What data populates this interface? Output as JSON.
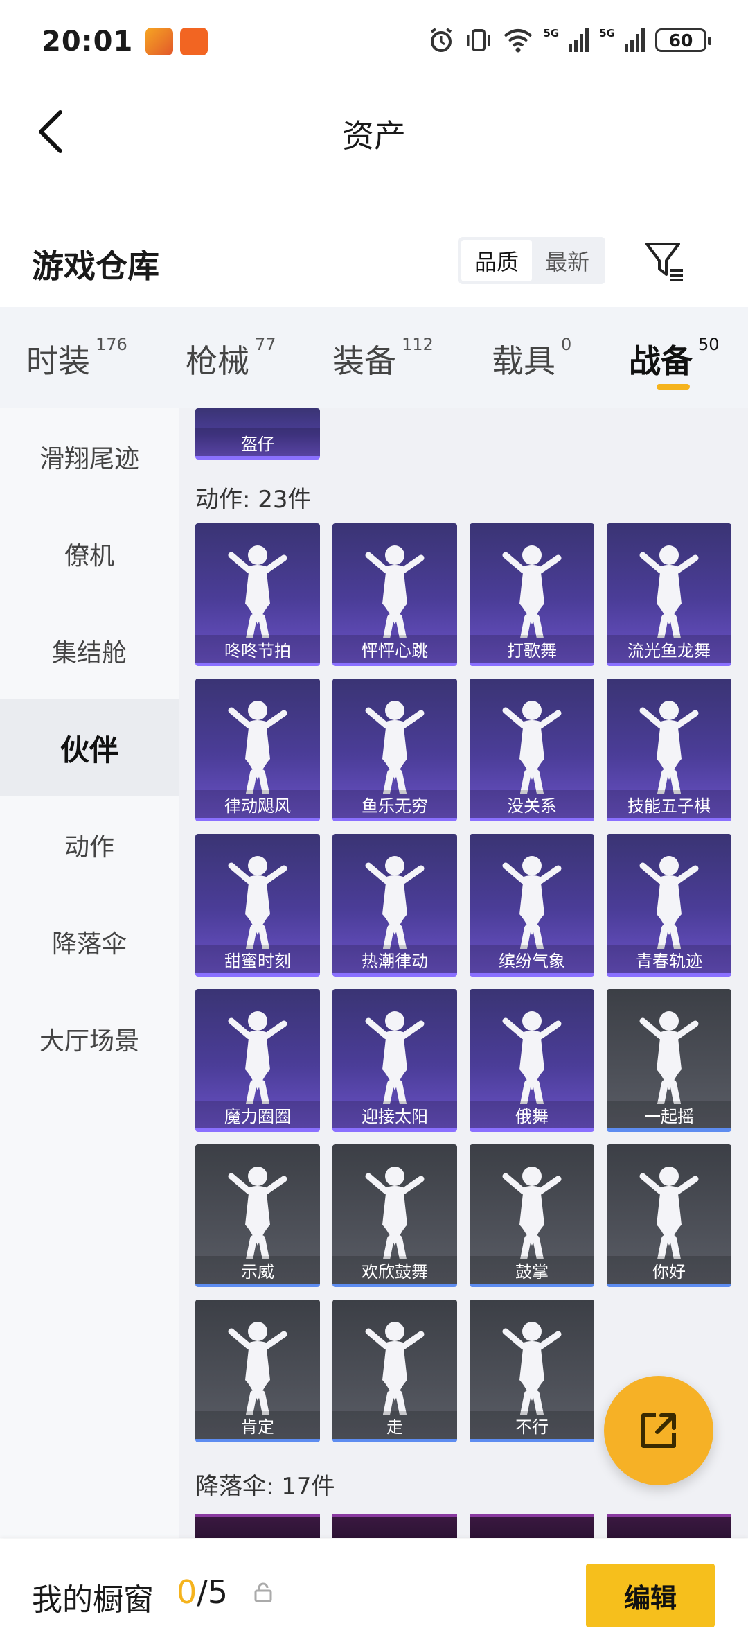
{
  "status_bar": {
    "time": "20:01",
    "battery": "60",
    "net1": "5G",
    "net2": "5G"
  },
  "header": {
    "title": "资产"
  },
  "warehouse": {
    "title": "游戏仓库",
    "sort_options": [
      "品质",
      "最新"
    ],
    "active_sort": "品质"
  },
  "tabs": [
    {
      "label": "时装",
      "count": "176"
    },
    {
      "label": "枪械",
      "count": "77"
    },
    {
      "label": "装备",
      "count": "112"
    },
    {
      "label": "载具",
      "count": "0"
    },
    {
      "label": "战备",
      "count": "50"
    }
  ],
  "active_tab": "战备",
  "sidebar": {
    "items": [
      "滑翔尾迹",
      "僚机",
      "集结舱",
      "伙伴",
      "动作",
      "降落伞",
      "大厅场景"
    ],
    "active": "伙伴"
  },
  "content": {
    "prev_item_label": "盔仔",
    "emote_section": "动作: 23件",
    "emotes": [
      {
        "label": "咚咚节拍",
        "rarity": "purple"
      },
      {
        "label": "怦怦心跳",
        "rarity": "purple"
      },
      {
        "label": "打歌舞",
        "rarity": "purple"
      },
      {
        "label": "流光鱼龙舞",
        "rarity": "purple"
      },
      {
        "label": "律动飓风",
        "rarity": "purple"
      },
      {
        "label": "鱼乐无穷",
        "rarity": "purple"
      },
      {
        "label": "没关系",
        "rarity": "purple"
      },
      {
        "label": "技能五子棋",
        "rarity": "purple"
      },
      {
        "label": "甜蜜时刻",
        "rarity": "purple"
      },
      {
        "label": "热潮律动",
        "rarity": "purple"
      },
      {
        "label": "缤纷气象",
        "rarity": "purple"
      },
      {
        "label": "青春轨迹",
        "rarity": "purple"
      },
      {
        "label": "魔力圈圈",
        "rarity": "purple"
      },
      {
        "label": "迎接太阳",
        "rarity": "purple"
      },
      {
        "label": "俄舞",
        "rarity": "purple"
      },
      {
        "label": "一起摇",
        "rarity": "gray"
      },
      {
        "label": "示威",
        "rarity": "gray"
      },
      {
        "label": "欢欣鼓舞",
        "rarity": "gray"
      },
      {
        "label": "鼓掌",
        "rarity": "gray"
      },
      {
        "label": "你好",
        "rarity": "gray"
      },
      {
        "label": "肯定",
        "rarity": "gray"
      },
      {
        "label": "走",
        "rarity": "gray"
      },
      {
        "label": "不行",
        "rarity": "gray"
      }
    ],
    "parachute_section": "降落伞: 17件"
  },
  "bottom_bar": {
    "showcase_label": "我的橱窗",
    "showcase_current": "0",
    "showcase_total": "/5",
    "edit_label": "编辑"
  },
  "colors": {
    "accent": "#f6bf1c",
    "purple_card": "#4b3d98",
    "gray_card": "#4d5058"
  }
}
